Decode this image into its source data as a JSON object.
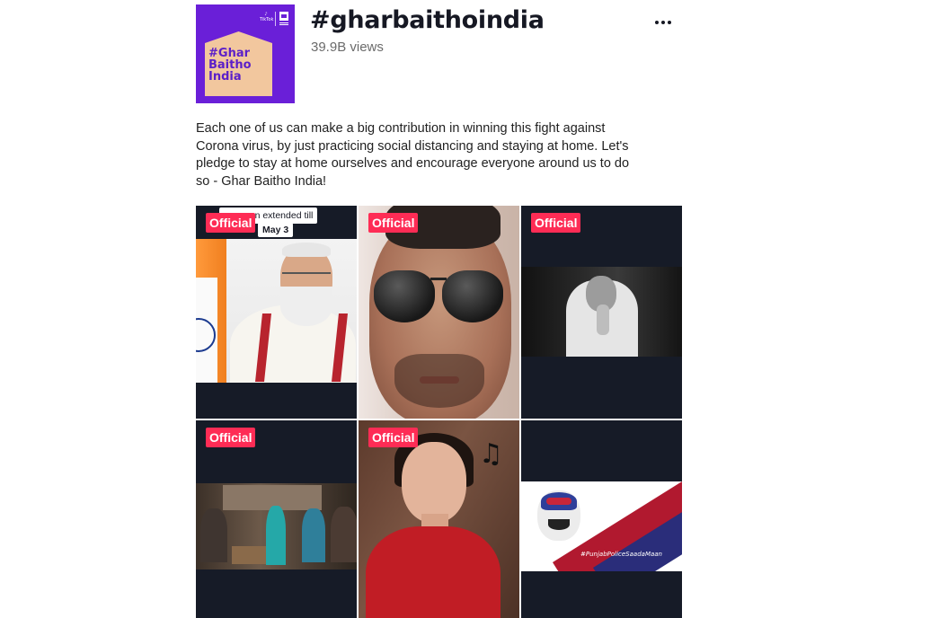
{
  "hashtag": {
    "title": "#gharbaithoindia",
    "views": "39.9B views",
    "cover_text": [
      "#Ghar",
      "Baitho",
      "India"
    ],
    "cover_badge": "TikTok",
    "description": "Each one of us can make a big contribution in winning this fight against Corona virus, by just practicing social distancing and staying at home. Let's pledge to stay at home ourselves and encourage everyone around us to do so - Ghar Baitho India!"
  },
  "menu": {
    "icon": "more-dots-icon"
  },
  "videos": [
    {
      "badge": "Official",
      "caption_line1": "wn extended till",
      "caption_line2": "May 3"
    },
    {
      "badge": "Official"
    },
    {
      "badge": "Official"
    },
    {
      "badge": "Official"
    },
    {
      "badge": "Official",
      "overlay": "♫"
    },
    {
      "badge": "",
      "overlay_tag": "#PunjabPoliceSaadaMaan"
    }
  ],
  "colors": {
    "badge": "#fe2c55",
    "cover": "#6a1fd8",
    "tile_bg": "#161b27"
  }
}
